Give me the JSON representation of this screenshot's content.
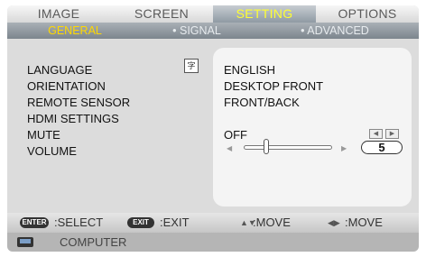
{
  "tabs": [
    "IMAGE",
    "SCREEN",
    "SETTING",
    "OPTIONS"
  ],
  "active_tab": "SETTING",
  "subtabs": [
    "GENERAL",
    "• SIGNAL",
    "• ADVANCED"
  ],
  "active_subtab": "GENERAL",
  "settings": [
    {
      "label": "LANGUAGE",
      "value": "ENGLISH"
    },
    {
      "label": "ORIENTATION",
      "value": "DESKTOP FRONT"
    },
    {
      "label": "REMOTE SENSOR",
      "value": "FRONT/BACK"
    },
    {
      "label": "HDMI SETTINGS",
      "value": ""
    },
    {
      "label": "MUTE",
      "value": "OFF"
    },
    {
      "label": "VOLUME",
      "value": "5"
    }
  ],
  "volume_level": 0.25,
  "language_icon": "language-select-icon",
  "navigation": [
    {
      "key": "ENTER",
      "label": ":SELECT"
    },
    {
      "key": "EXIT",
      "label": ":EXIT"
    },
    {
      "key": "up-down-arrows-icon",
      "label": ":MOVE"
    },
    {
      "key": "left-right-arrows-icon",
      "label": ":MOVE"
    }
  ],
  "source": "COMPUTER",
  "colors": {
    "active_tab_text": "#ffff33",
    "active_subtab_text": "#ffd800",
    "panel_bg": "#dcdcdc",
    "values_bg": "#f4f4f4"
  }
}
